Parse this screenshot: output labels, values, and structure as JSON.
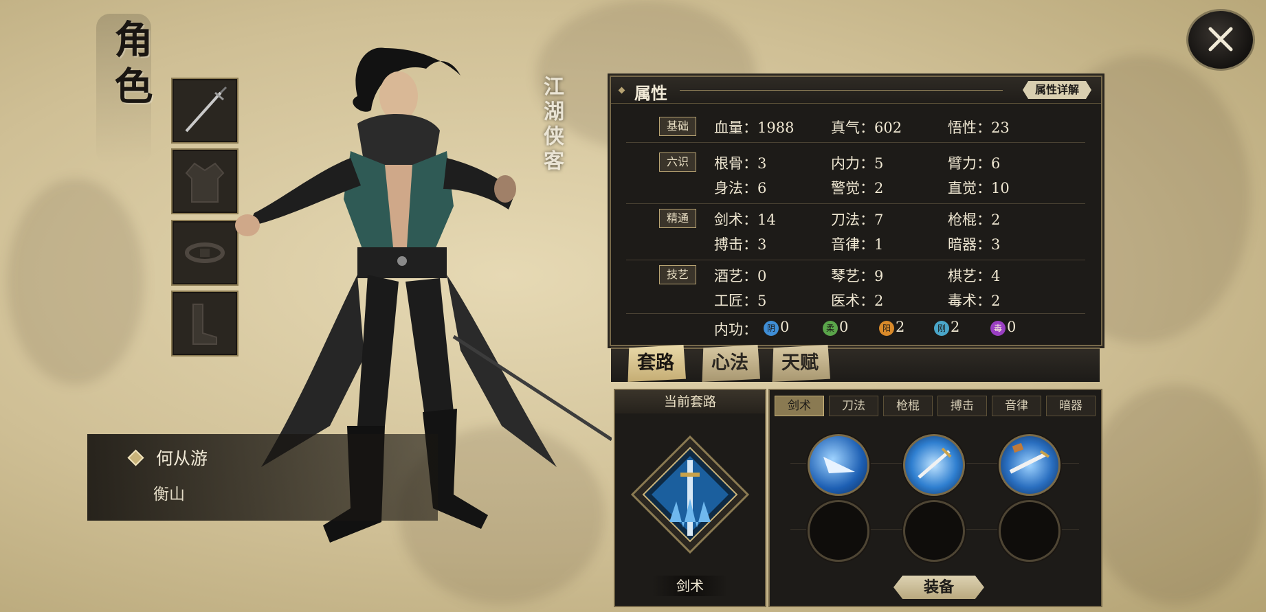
{
  "page_title": "角色",
  "character": {
    "title": "江湖侠客",
    "name": "何从游",
    "origin": "衡山"
  },
  "equipment_slots": [
    {
      "icon": "sword-icon"
    },
    {
      "icon": "robe-icon"
    },
    {
      "icon": "belt-icon"
    },
    {
      "icon": "boots-icon"
    }
  ],
  "attributes": {
    "title": "属性",
    "detail_button": "属性详解",
    "groups": [
      {
        "label": "基础",
        "stats": [
          {
            "label": "血量：1988"
          },
          {
            "label": "真气：602"
          },
          {
            "label": "悟性：23"
          }
        ]
      },
      {
        "label": "六识",
        "stats": [
          {
            "label": "根骨：3"
          },
          {
            "label": "内力：5"
          },
          {
            "label": "臂力：6"
          },
          {
            "label": "身法：6"
          },
          {
            "label": "警觉：2"
          },
          {
            "label": "直觉：10"
          }
        ]
      },
      {
        "label": "精通",
        "stats": [
          {
            "label": "剑术：14"
          },
          {
            "label": "刀法：7"
          },
          {
            "label": "枪棍：2"
          },
          {
            "label": "搏击：3"
          },
          {
            "label": "音律：1"
          },
          {
            "label": "暗器：3"
          }
        ]
      },
      {
        "label": "技艺",
        "stats": [
          {
            "label": "酒艺：0"
          },
          {
            "label": "琴艺：9"
          },
          {
            "label": "棋艺：4"
          },
          {
            "label": "工匠：5"
          },
          {
            "label": "医术：2"
          },
          {
            "label": "毒术：2"
          }
        ]
      }
    ],
    "neigong": {
      "label": "内功：",
      "items": [
        {
          "glyph": "阴",
          "value": "0",
          "color": "#3f8ed6"
        },
        {
          "glyph": "柔",
          "value": "0",
          "color": "#5aa54a"
        },
        {
          "glyph": "阳",
          "value": "2",
          "color": "#d98a2a"
        },
        {
          "glyph": "刚",
          "value": "2",
          "color": "#4aa6c9"
        },
        {
          "glyph": "毒",
          "value": "0",
          "color": "#9a3fc2"
        }
      ]
    }
  },
  "main_tabs": [
    {
      "label": "套路",
      "active": true
    },
    {
      "label": "心法",
      "active": false
    },
    {
      "label": "天赋",
      "active": false
    }
  ],
  "routine": {
    "header": "当前套路",
    "name": "剑术"
  },
  "skill_tabs": [
    {
      "label": "剑术",
      "active": true
    },
    {
      "label": "刀法",
      "active": false
    },
    {
      "label": "枪棍",
      "active": false
    },
    {
      "label": "搏击",
      "active": false
    },
    {
      "label": "音律",
      "active": false
    },
    {
      "label": "暗器",
      "active": false
    }
  ],
  "equip_button": "装备",
  "colors": {
    "panel_bg": "#1d1b18",
    "panel_border": "#77694a",
    "text_light": "#efe7d2",
    "accent_gold": "#c9b37a"
  }
}
